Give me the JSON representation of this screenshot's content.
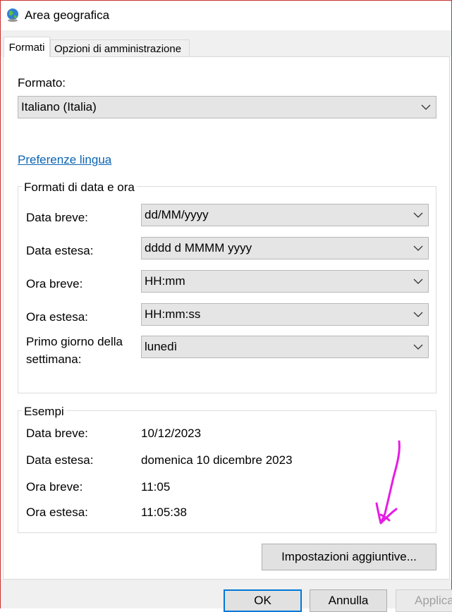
{
  "window": {
    "title": "Area geografica",
    "icon": "globe-icon"
  },
  "tabs": [
    {
      "label": "Formati",
      "active": true
    },
    {
      "label": "Opzioni di amministrazione",
      "active": false
    }
  ],
  "format": {
    "label": "Formato:",
    "value": "Italiano (Italia)"
  },
  "language_link": "Preferenze lingua",
  "date_time_formats": {
    "title": "Formati di data e ora",
    "short_date_label": "Data breve:",
    "short_date_value": "dd/MM/yyyy",
    "long_date_label": "Data estesa:",
    "long_date_value": "dddd d MMMM yyyy",
    "short_time_label": "Ora breve:",
    "short_time_value": "HH:mm",
    "long_time_label": "Ora estesa:",
    "long_time_value": "HH:mm:ss",
    "first_day_label_line1": "Primo giorno della",
    "first_day_label_line2": "settimana:",
    "first_day_value": "lunedì"
  },
  "examples": {
    "title": "Esempi",
    "short_date_label": "Data breve:",
    "short_date_value": "10/12/2023",
    "long_date_label": "Data estesa:",
    "long_date_value": "domenica 10 dicembre 2023",
    "short_time_label": "Ora breve:",
    "short_time_value": "11:05",
    "long_time_label": "Ora estesa:",
    "long_time_value": "11:05:38"
  },
  "buttons": {
    "additional_settings": "Impostazioni aggiuntive...",
    "ok": "OK",
    "cancel": "Annulla",
    "apply": "Applica"
  },
  "colors": {
    "link": "#0a64b4",
    "annotation": "#e61ce6",
    "default_button_border": "#0078d7"
  }
}
